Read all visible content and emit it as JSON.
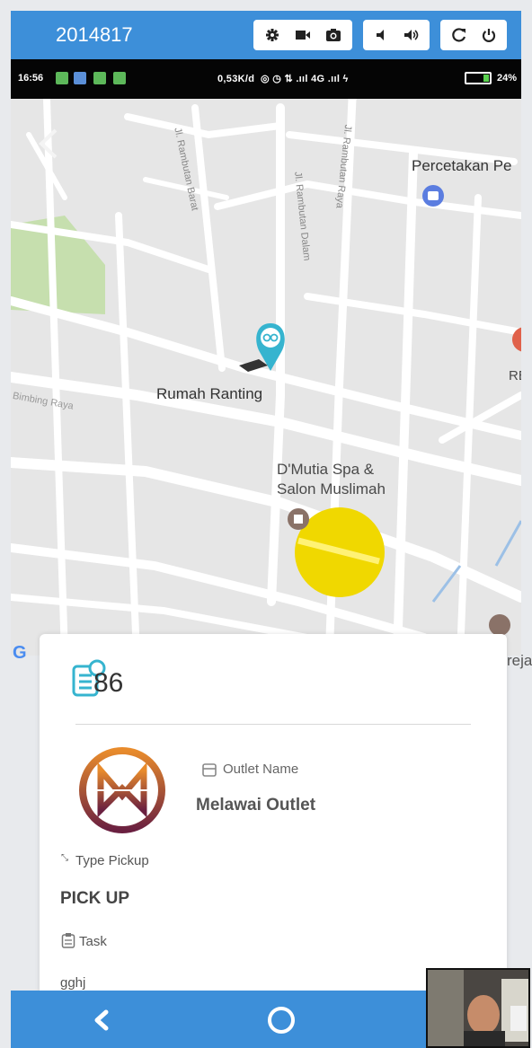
{
  "emulator": {
    "title": "2014817",
    "controls": [
      "settings-icon",
      "video-icon",
      "camera-icon",
      "volume-down-icon",
      "volume-up-icon",
      "rotate-icon",
      "power-icon"
    ]
  },
  "status_bar": {
    "time": "16:56",
    "network_speed": "0,53K/d",
    "signal_text": "4G",
    "battery_percent": "24%",
    "battery_level": 0.24
  },
  "map": {
    "places": {
      "percetakan": "Percetakan Pe",
      "rumah_ranting": "Rumah Ranting",
      "dmutia_line1": "D'Mutia Spa &",
      "dmutia_line2": "Salon Muslimah",
      "rb": "RB",
      "reja": "reja"
    },
    "streets": {
      "rambutan_barat": "Jl. Rambutan Barat",
      "rambutan_dalam": "Jl. Rambutan Dalam",
      "rambutan_raya": "Jl. Rambutan Raya",
      "bimbing_raya": "Bimbing Raya"
    },
    "google_letter": "G",
    "colors": {
      "road": "#ffffff",
      "land": "#e6e6e6",
      "park": "#c6dfae",
      "pin": "#36b4cf",
      "current_location": "#f0d800"
    }
  },
  "card": {
    "order_id": "86",
    "outlet_label": "Outlet Name",
    "outlet_name": "Melawai Outlet",
    "type_label": "Type Pickup",
    "type_value": "PICK UP",
    "task_label": "Task",
    "task_value": "gghj"
  },
  "nav": {
    "back": "back-icon",
    "home": "home-icon"
  }
}
